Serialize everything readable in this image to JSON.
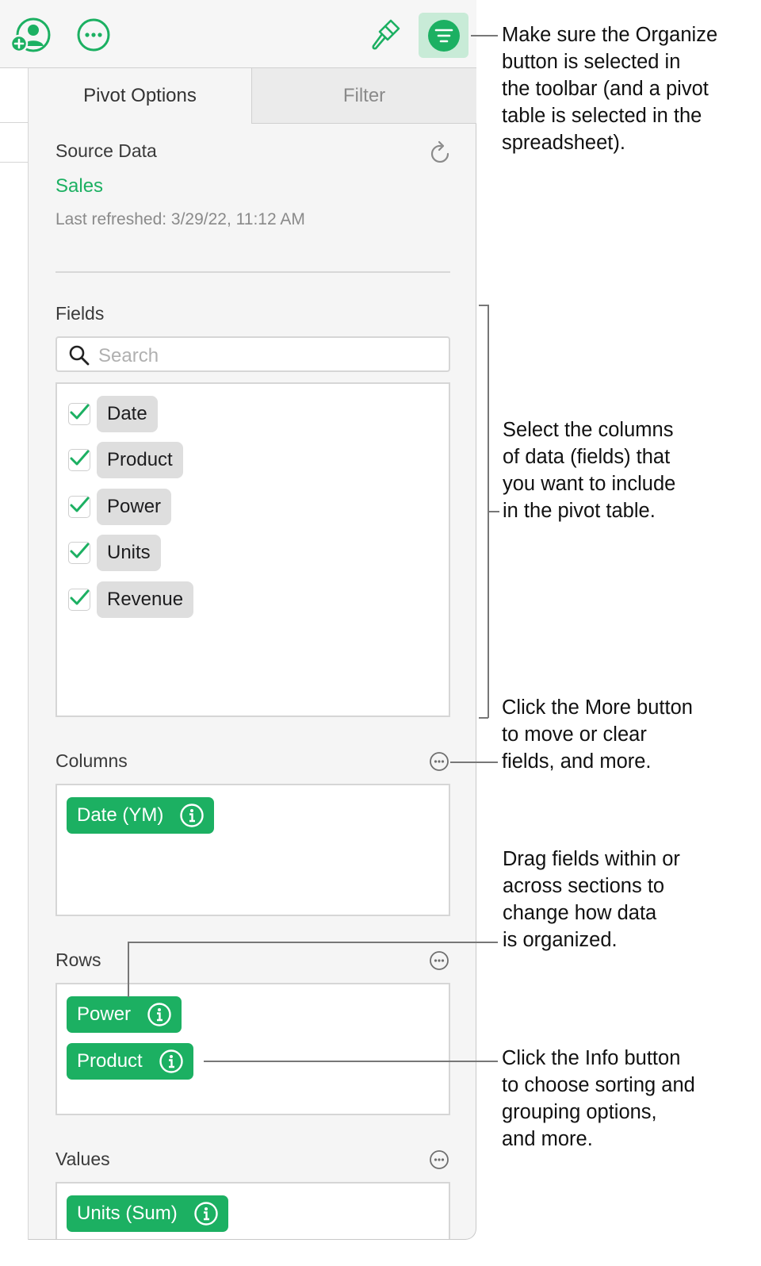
{
  "toolbar": {
    "collaborate_icon": "person-add-icon",
    "more_icon": "ellipsis-circle-icon",
    "format_icon": "paintbrush-icon",
    "organize_icon": "organize-icon",
    "accent": "#1cb062"
  },
  "tabs": [
    {
      "label": "Pivot Options",
      "selected": true
    },
    {
      "label": "Filter",
      "selected": false
    }
  ],
  "source_data": {
    "heading": "Source Data",
    "table_name": "Sales",
    "last_refreshed": "Last refreshed: 3/29/22, 11:12 AM",
    "refresh_icon": "refresh-icon"
  },
  "fields": {
    "heading": "Fields",
    "search_placeholder": "Search",
    "items": [
      {
        "label": "Date",
        "checked": true
      },
      {
        "label": "Product",
        "checked": true
      },
      {
        "label": "Power",
        "checked": true
      },
      {
        "label": "Units",
        "checked": true
      },
      {
        "label": "Revenue",
        "checked": true
      }
    ]
  },
  "columns": {
    "heading": "Columns",
    "items": [
      {
        "label": "Date (YM)"
      }
    ]
  },
  "rows": {
    "heading": "Rows",
    "items": [
      {
        "label": "Power"
      },
      {
        "label": "Product"
      }
    ]
  },
  "values": {
    "heading": "Values",
    "items": [
      {
        "label": "Units (Sum)"
      }
    ]
  },
  "callouts": {
    "organize": [
      "Make sure the Organize",
      "button is selected in",
      "the toolbar (and a pivot",
      "table is selected in the",
      "spreadsheet)."
    ],
    "fields": [
      "Select the columns",
      "of data (fields) that",
      "you want to include",
      "in the pivot table."
    ],
    "more": [
      "Click the More button",
      "to move or clear",
      "fields, and more."
    ],
    "drag": [
      "Drag fields within or",
      "across sections to",
      "change how data",
      "is organized."
    ],
    "info": [
      "Click the Info button",
      "to choose sorting and",
      "grouping options,",
      "and more."
    ]
  }
}
